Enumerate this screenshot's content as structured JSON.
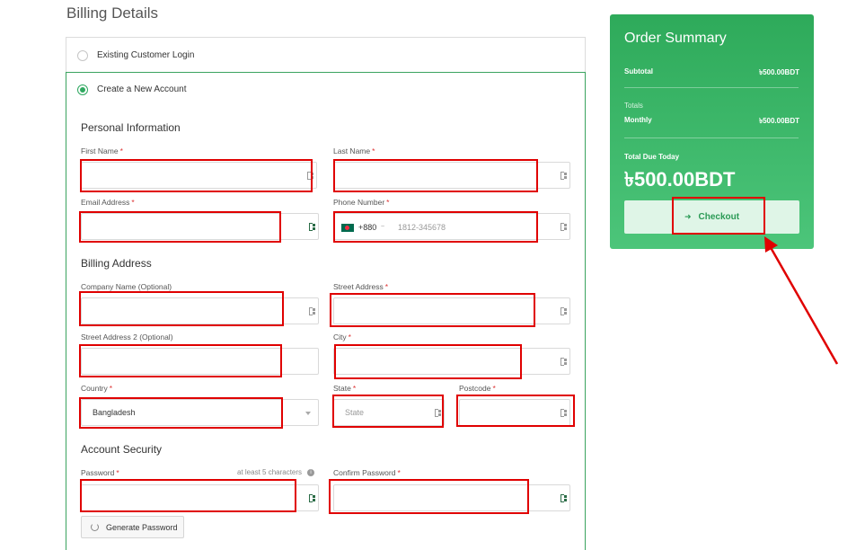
{
  "page": {
    "title": "Billing Details"
  },
  "account_choice": {
    "existing_label": "Existing Customer Login",
    "new_label": "Create a New Account"
  },
  "personal": {
    "title": "Personal Information",
    "first_name_label": "First Name",
    "last_name_label": "Last Name",
    "email_label": "Email Address",
    "phone_label": "Phone Number",
    "phone_dial_code": "+880",
    "phone_caret": "~",
    "phone_placeholder": "1812-345678"
  },
  "billing": {
    "title": "Billing Address",
    "company_label": "Company Name (Optional)",
    "street_label": "Street Address",
    "street2_label": "Street Address 2 (Optional)",
    "city_label": "City",
    "country_label": "Country",
    "country_value": "Bangladesh",
    "state_label": "State",
    "state_placeholder": "State",
    "postcode_label": "Postcode"
  },
  "security": {
    "title": "Account Security",
    "password_label": "Password",
    "password_hint": "at least 5 characters",
    "confirm_label": "Confirm Password",
    "generate_label": "Generate Password"
  },
  "required_mark": "*",
  "summary": {
    "title": "Order Summary",
    "subtotal_label": "Subtotal",
    "subtotal_value": "৳500.00BDT",
    "totals_label": "Totals",
    "monthly_label": "Monthly",
    "monthly_value": "৳500.00BDT",
    "total_due_label": "Total Due Today",
    "total_due_value": "৳500.00BDT",
    "checkout_label": "Checkout",
    "checkout_icon": "arrow-right-icon"
  },
  "colors": {
    "accent_green": "#2eaa5a",
    "annotation_red": "#e00000"
  }
}
